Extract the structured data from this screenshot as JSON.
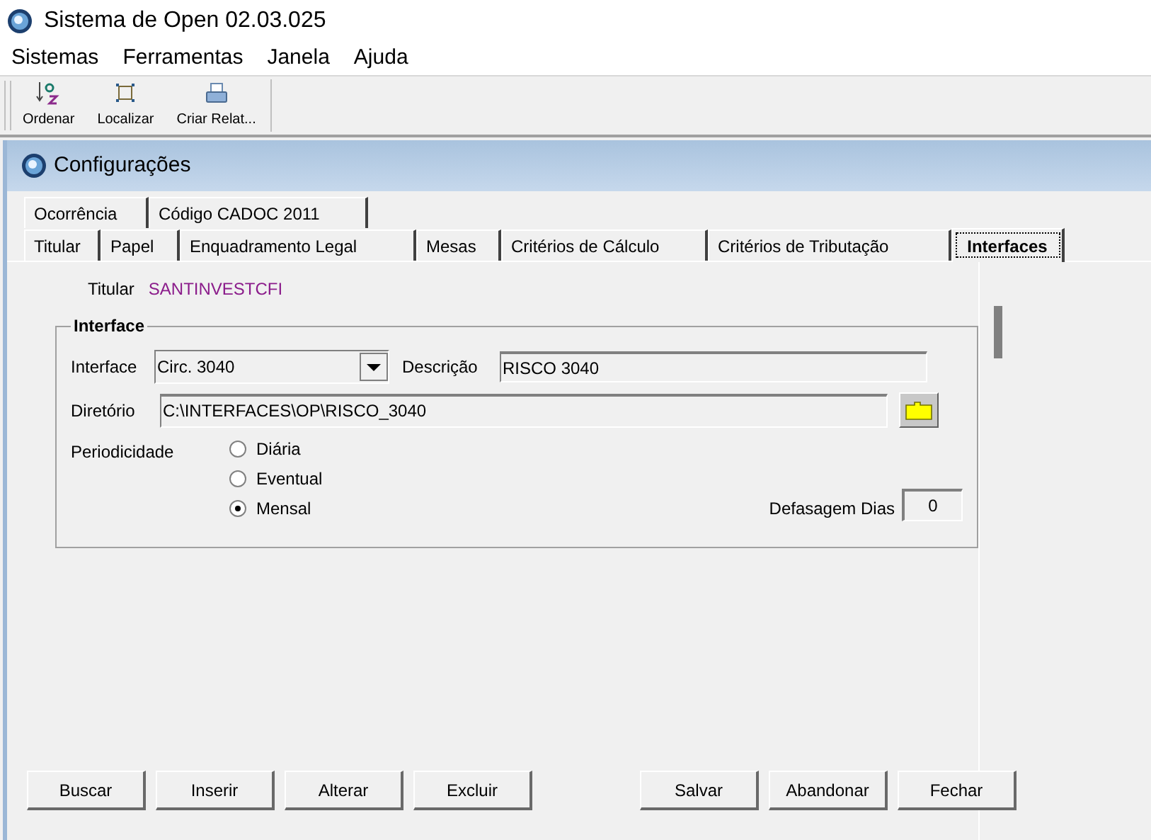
{
  "window": {
    "title": "Sistema de Open 02.03.025"
  },
  "menu": [
    "Sistemas",
    "Ferramentas",
    "Janela",
    "Ajuda"
  ],
  "toolbar": [
    {
      "label": "Ordenar",
      "kind": "sort"
    },
    {
      "label": "Localizar",
      "kind": "find"
    },
    {
      "label": "Criar Relat...",
      "kind": "report"
    }
  ],
  "child_window": {
    "title": "Configurações"
  },
  "tabs_row_1": [
    {
      "label": "Ocorrência",
      "selected": false
    },
    {
      "label": "Código CADOC 2011",
      "selected": false
    }
  ],
  "tabs_row_2": [
    {
      "label": "Titular",
      "selected": false
    },
    {
      "label": "Papel",
      "selected": false
    },
    {
      "label": "Enquadramento Legal",
      "selected": false
    },
    {
      "label": "Mesas",
      "selected": false
    },
    {
      "label": "Critérios de Cálculo",
      "selected": false
    },
    {
      "label": "Critérios de Tributação",
      "selected": false
    },
    {
      "label": "Interfaces",
      "selected": true
    }
  ],
  "titular": {
    "label": "Titular",
    "value": "SANTINVESTCFI"
  },
  "interface_group": {
    "title": "Interface",
    "interface": {
      "label": "Interface",
      "value": "Circ. 3040"
    },
    "descricao": {
      "label": "Descrição",
      "value": "RISCO 3040"
    },
    "diretorio": {
      "label": "Diretório",
      "value": "C:\\INTERFACES\\OP\\RISCO_3040"
    },
    "periodicidade": {
      "label": "Periodicidade",
      "options": [
        {
          "label": "Diária",
          "selected": false
        },
        {
          "label": "Eventual",
          "selected": false
        },
        {
          "label": "Mensal",
          "selected": true
        }
      ]
    },
    "defasagem": {
      "label": "Defasagem Dias",
      "value": "0"
    }
  },
  "buttons_left": [
    "Buscar",
    "Inserir",
    "Alterar",
    "Excluir"
  ],
  "buttons_right": [
    "Salvar",
    "Abandonar",
    "Fechar"
  ]
}
